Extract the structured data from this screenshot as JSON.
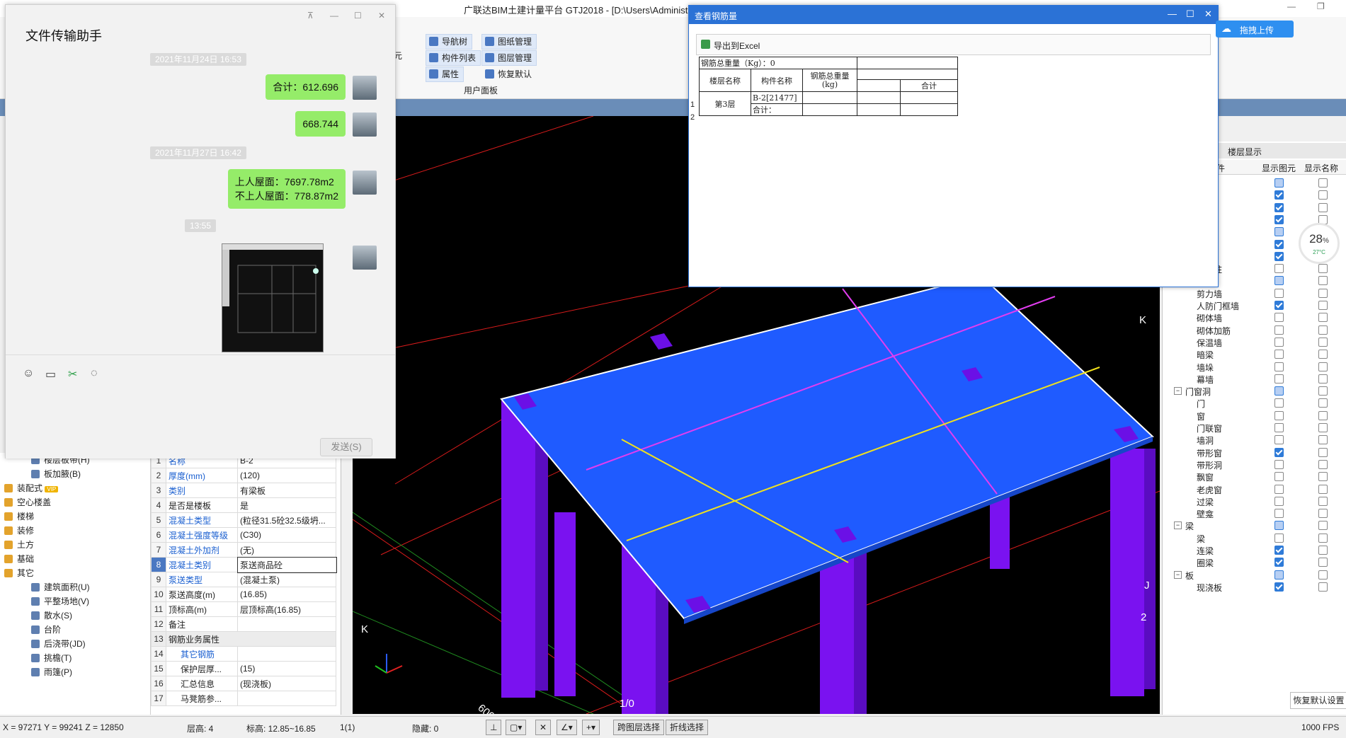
{
  "app": {
    "title": "广联达BIM土建计量平台 GTJ2018 - [D:\\Users\\Administra",
    "ribbon_buttons": [
      "导航树",
      "图纸管理",
      "构件列表",
      "图层管理",
      "属性",
      "恢复默认"
    ],
    "ribbon_group_label": "用户面板",
    "ribbon_fragment": "元",
    "cloud_upload": "拖拽上传"
  },
  "chat": {
    "title": "文件传输助手",
    "messages": [
      {
        "stamp": "2021年11月24日 16:53"
      },
      {
        "text": "合计：612.696"
      },
      {
        "text": "668.744"
      },
      {
        "stamp": "2021年11月27日 16:42"
      },
      {
        "text_line1": "上人屋面：7697.78m2",
        "text_line2": "不上人屋面：778.87m2"
      },
      {
        "stamp": "13:55"
      }
    ],
    "send_label": "发送(S)",
    "toolbar_icons": [
      "emoji-icon",
      "folder-icon",
      "scissors-icon",
      "chat-history-icon"
    ]
  },
  "rebar_dialog": {
    "title": "查看钢筋量",
    "export_label": "导出到Excel",
    "total_weight_label": "钢筋总重量（Kg）：0",
    "headers": {
      "floor": "楼层名称",
      "component": "构件名称",
      "weight": "钢筋总重量(kg)",
      "sum": "合计"
    },
    "row_numbers": [
      "1",
      "2"
    ],
    "floor": "第3层",
    "component": "B-2[21477]",
    "subtotal_label": "合计："
  },
  "left_nav": {
    "items": [
      {
        "label": "楼层板带(H)",
        "indent": true
      },
      {
        "label": "板加腋(B)",
        "indent": true
      },
      {
        "label": "装配式",
        "badge": "VIP"
      },
      {
        "label": "空心楼盖"
      },
      {
        "label": "楼梯"
      },
      {
        "label": "装修"
      },
      {
        "label": "土方"
      },
      {
        "label": "基础"
      },
      {
        "label": "其它"
      },
      {
        "label": "建筑面积(U)",
        "indent": true
      },
      {
        "label": "平整场地(V)",
        "indent": true
      },
      {
        "label": "散水(S)",
        "indent": true
      },
      {
        "label": "台阶",
        "indent": true
      },
      {
        "label": "后浇带(JD)",
        "indent": true
      },
      {
        "label": "挑檐(T)",
        "indent": true
      },
      {
        "label": "雨篷(P)",
        "indent": true
      }
    ]
  },
  "properties": {
    "rows": [
      {
        "n": "1",
        "k": "名称",
        "v": "B-2",
        "blue": true
      },
      {
        "n": "2",
        "k": "厚度(mm)",
        "v": "(120)",
        "blue": true
      },
      {
        "n": "3",
        "k": "类别",
        "v": "有梁板",
        "blue": true
      },
      {
        "n": "4",
        "k": "是否是楼板",
        "v": "是"
      },
      {
        "n": "5",
        "k": "混凝土类型",
        "v": "(粒径31.5砼32.5级坍...",
        "blue": true
      },
      {
        "n": "6",
        "k": "混凝土强度等级",
        "v": "(C30)",
        "blue": true
      },
      {
        "n": "7",
        "k": "混凝土外加剂",
        "v": "(无)",
        "blue": true
      },
      {
        "n": "8",
        "k": "混凝土类别",
        "v": "泵送商品砼",
        "blue": true,
        "selected": true
      },
      {
        "n": "9",
        "k": "泵送类型",
        "v": "(混凝土泵)",
        "blue": true
      },
      {
        "n": "10",
        "k": "泵送高度(m)",
        "v": "(16.85)"
      },
      {
        "n": "11",
        "k": "顶标高(m)",
        "v": "层顶标高(16.85)"
      },
      {
        "n": "12",
        "k": "备注",
        "v": ""
      },
      {
        "n": "13",
        "k": "钢筋业务属性",
        "v": "",
        "group": true
      },
      {
        "n": "14",
        "k": "其它钢筋",
        "v": "",
        "blue": true,
        "sub": true
      },
      {
        "n": "15",
        "k": "保护层厚...",
        "v": "(15)",
        "sub": true
      },
      {
        "n": "16",
        "k": "汇总信息",
        "v": "(现浇板)",
        "sub": true
      },
      {
        "n": "17",
        "k": "马凳筋参...",
        "v": "",
        "sub": true
      }
    ]
  },
  "layers": {
    "tab": "楼层显示",
    "col_component": "件",
    "col_show_elem": "显示图元",
    "col_show_name": "显示名称",
    "rows": [
      {
        "label": "",
        "level": 1,
        "elem": "part",
        "name": false
      },
      {
        "label": "",
        "level": 1,
        "elem": "on",
        "name": false
      },
      {
        "label": "",
        "level": 1,
        "elem": "on",
        "name": false
      },
      {
        "label": "线",
        "level": 1,
        "elem": "on",
        "name": false
      },
      {
        "label": "",
        "level": 1,
        "elem": "part",
        "name": false
      },
      {
        "label": "",
        "level": 1,
        "elem": "on",
        "name": false
      },
      {
        "label": "",
        "level": 1,
        "elem": "on",
        "name": false
      },
      {
        "label": "砌体柱",
        "level": 2,
        "elem": "off",
        "name": false
      },
      {
        "label": "墙",
        "level": 0,
        "elem": "part",
        "name": false
      },
      {
        "label": "剪力墙",
        "level": 2,
        "elem": "off",
        "name": false
      },
      {
        "label": "人防门框墙",
        "level": 2,
        "elem": "on",
        "name": false
      },
      {
        "label": "砌体墙",
        "level": 2,
        "elem": "off",
        "name": false
      },
      {
        "label": "砌体加筋",
        "level": 2,
        "elem": "off",
        "name": false
      },
      {
        "label": "保温墙",
        "level": 2,
        "elem": "off",
        "name": false
      },
      {
        "label": "暗梁",
        "level": 2,
        "elem": "off",
        "name": false
      },
      {
        "label": "墙垛",
        "level": 2,
        "elem": "off",
        "name": false
      },
      {
        "label": "幕墙",
        "level": 2,
        "elem": "off",
        "name": false
      },
      {
        "label": "门窗洞",
        "level": 0,
        "elem": "part",
        "name": false
      },
      {
        "label": "门",
        "level": 2,
        "elem": "off",
        "name": false
      },
      {
        "label": "窗",
        "level": 2,
        "elem": "off",
        "name": false
      },
      {
        "label": "门联窗",
        "level": 2,
        "elem": "off",
        "name": false
      },
      {
        "label": "墙洞",
        "level": 2,
        "elem": "off",
        "name": false
      },
      {
        "label": "带形窗",
        "level": 2,
        "elem": "on",
        "name": false
      },
      {
        "label": "带形洞",
        "level": 2,
        "elem": "off",
        "name": false
      },
      {
        "label": "飘窗",
        "level": 2,
        "elem": "off",
        "name": false
      },
      {
        "label": "老虎窗",
        "level": 2,
        "elem": "off",
        "name": false
      },
      {
        "label": "过梁",
        "level": 2,
        "elem": "off",
        "name": false
      },
      {
        "label": "壁龛",
        "level": 2,
        "elem": "off",
        "name": false
      },
      {
        "label": "梁",
        "level": 0,
        "elem": "part",
        "name": false
      },
      {
        "label": "梁",
        "level": 2,
        "elem": "off",
        "name": false
      },
      {
        "label": "连梁",
        "level": 2,
        "elem": "on",
        "name": false
      },
      {
        "label": "圈梁",
        "level": 2,
        "elem": "on",
        "name": false
      },
      {
        "label": "板",
        "level": 0,
        "elem": "part",
        "name": false
      },
      {
        "label": "现浇板",
        "level": 2,
        "elem": "on",
        "name": false
      }
    ],
    "restore_default": "恢复默认设置"
  },
  "viewport": {
    "axis_labels": [
      "K",
      "K",
      "2",
      "J",
      "1/0",
      "600"
    ],
    "gauge_percent": "28",
    "gauge_unit": "%",
    "gauge_temp": "27°C"
  },
  "status": {
    "coords": "X = 97271 Y = 99241 Z = 12850",
    "floor_height": "层高:  4",
    "elevation": "标高:  12.85~16.85",
    "count": "1(1)",
    "hidden": "隐藏:  0",
    "cross_layer": "跨图层选择",
    "polyline_select": "折线选择",
    "fps": "1000 FPS"
  },
  "colors": {
    "slab": "#1f5bff",
    "column": "#7a12f0",
    "accent": "#2b72d6",
    "bubble": "#95ec69"
  }
}
